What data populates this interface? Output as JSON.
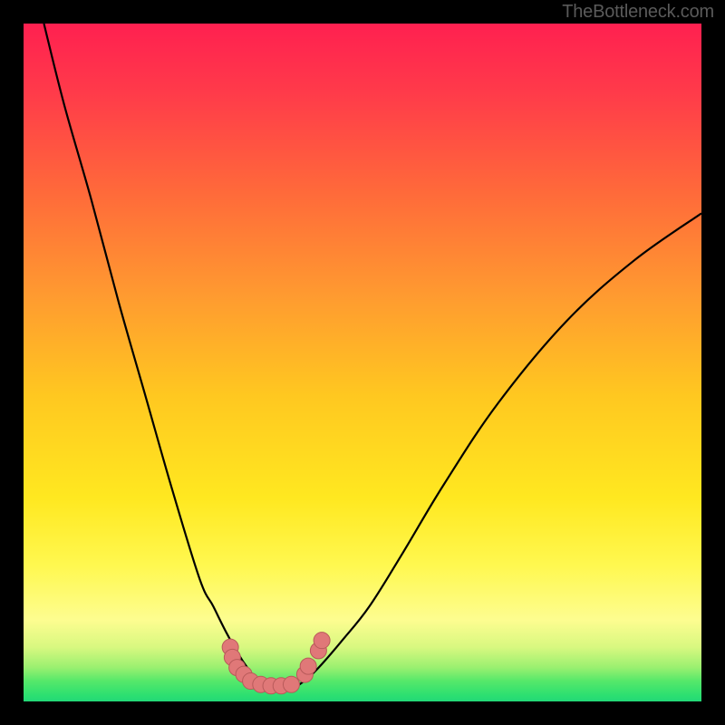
{
  "watermark": "TheBottleneck.com",
  "colors": {
    "curve_stroke": "#000000",
    "marker_fill": "#E07878",
    "marker_stroke": "#B85A5A",
    "frame": "#000000"
  },
  "chart_data": {
    "type": "line",
    "title": "",
    "xlabel": "",
    "ylabel": "",
    "xlim": [
      0,
      100
    ],
    "ylim": [
      0,
      100
    ],
    "grid": false,
    "axes_visible": false,
    "curve_left": {
      "x": [
        3,
        6,
        10,
        14,
        18,
        22,
        26,
        28,
        30,
        32,
        33,
        34,
        35,
        36
      ],
      "y": [
        100,
        88,
        74,
        59,
        45,
        31,
        18,
        14,
        10,
        6.5,
        5,
        3.5,
        2.5,
        2
      ]
    },
    "curve_right": {
      "x": [
        40,
        42,
        44,
        47,
        51,
        56,
        62,
        70,
        80,
        90,
        100
      ],
      "y": [
        2,
        3.5,
        5.5,
        9,
        14,
        22,
        32,
        44,
        56,
        65,
        72
      ]
    },
    "cluster_points": [
      {
        "x": 30.5,
        "y": 8.0
      },
      {
        "x": 30.8,
        "y": 6.5
      },
      {
        "x": 31.5,
        "y": 5.0
      },
      {
        "x": 32.5,
        "y": 4.0
      },
      {
        "x": 33.5,
        "y": 3.0
      },
      {
        "x": 35.0,
        "y": 2.5
      },
      {
        "x": 36.5,
        "y": 2.3
      },
      {
        "x": 38.0,
        "y": 2.3
      },
      {
        "x": 39.5,
        "y": 2.5
      },
      {
        "x": 41.5,
        "y": 4.0
      },
      {
        "x": 42.0,
        "y": 5.2
      },
      {
        "x": 43.5,
        "y": 7.5
      },
      {
        "x": 44.0,
        "y": 9.0
      }
    ]
  }
}
